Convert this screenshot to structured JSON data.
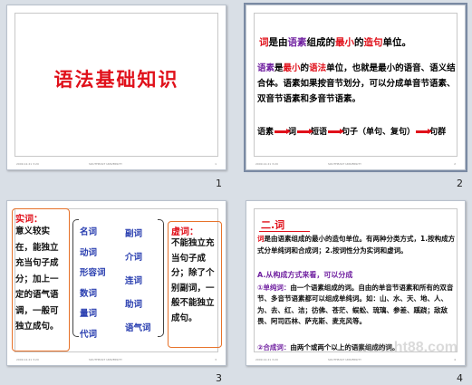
{
  "slides": [
    {
      "number": "1",
      "title": "语法基础知识",
      "footer_left": "2009.12.21 3:20",
      "footer_mid": "SOUTHEAST UNIVERSITY",
      "footer_right": "1"
    },
    {
      "number": "2",
      "line1_a": "词",
      "line1_b": "是由",
      "line1_c": "语素",
      "line1_d": "组成的",
      "line1_e": "最小",
      "line1_f": "的",
      "line1_g": "造句",
      "line1_h": "单位。",
      "p2_a": "语素",
      "p2_b": "是",
      "p2_c": "最小",
      "p2_d": "的",
      "p2_e": "语法",
      "p2_f": "单位，也就是最小的语音、语义结合体。语素如果按音节划分，可以分成单音节语素、双音节语素和多音节语素。",
      "chain": [
        "语素",
        "词",
        "短语",
        "句子（单句、复句）",
        "句群"
      ],
      "footer_left": "2009.12.21 3:20",
      "footer_mid": "SOUTHEAST UNIVERSITY",
      "footer_right": "2"
    },
    {
      "number": "3",
      "left_title": "实词：",
      "left_body": "意义较实在，能独立充当句子成分；加上一定的语气语调，一般可独立成句。",
      "col1": [
        "名词",
        "动词",
        "形容词",
        "数词",
        "量词",
        "代词"
      ],
      "col2": [
        "副词",
        "介词",
        "连词",
        "助词",
        "语气词"
      ],
      "right_title": "虚词：",
      "right_body": "不能独立充当句子成分；除了个别副词，一般不能独立成句。",
      "footer_left": "2009.12.21 3:20",
      "footer_mid": "SOUTHEAST UNIVERSITY",
      "footer_right": "3"
    },
    {
      "number": "4",
      "heading": "二.词",
      "intro_a": "词",
      "intro_b": "是由语素组成的最小的造句单位。有两种分类方式，1.按构成方式分单纯词和合成词；2.按词性分为实词和虚词。",
      "sub_a": "A.从构成方式来看，可以分成",
      "item1_label": "①单纯词：",
      "item1_text": "由一个语素组成的词。自由的单音节语素和所有的双音节、多音节语素都可以组成单纯词。如：山、水、天、地、人、为、去、红、洁；彷佛、苍茫、蜈蚣、琉璃、参差、蹊跷；敌敌畏、阿司匹林、萨克斯、麦克风等。",
      "item2_label": "②合成词：",
      "item2_text": "由两个或两个以上的语素组成的词。",
      "watermark": "www.ht88.com",
      "footer_left": "2009.12.21 3:20",
      "footer_mid": "SOUTHEAST UNIVERSITY",
      "footer_right": "4"
    }
  ]
}
